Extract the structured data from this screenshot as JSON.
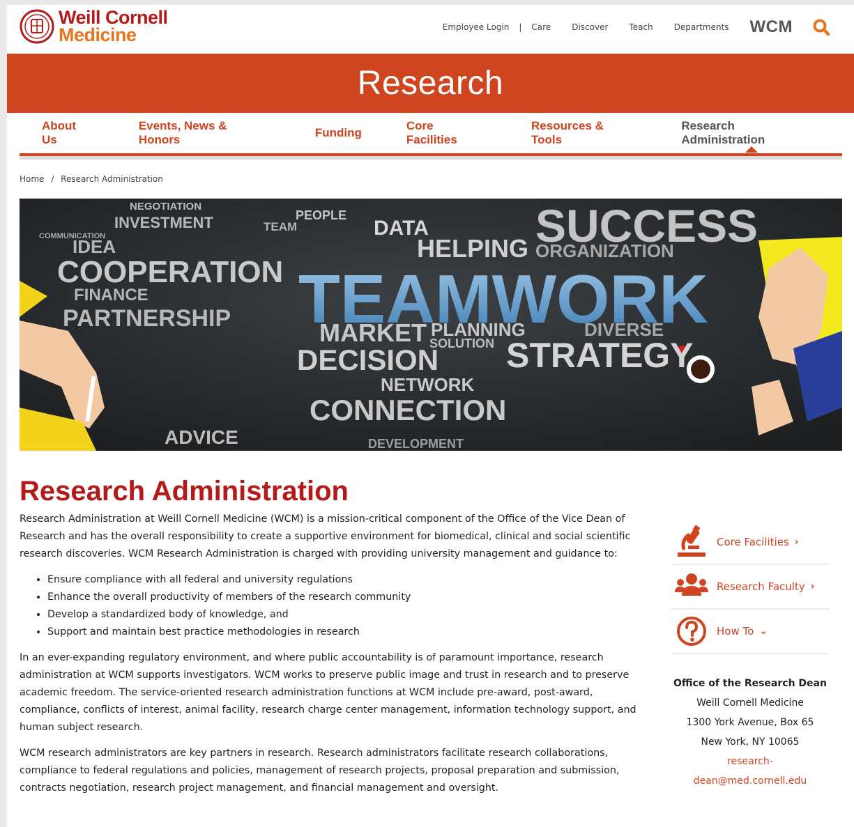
{
  "header": {
    "logo_line1": "Weill Cornell",
    "logo_line2": "Medicine",
    "utility": [
      "Employee Login",
      "Care",
      "Discover",
      "Teach",
      "Departments"
    ],
    "wcm": "WCM"
  },
  "banner": {
    "title": "Research"
  },
  "nav": {
    "items": [
      "About Us",
      "Events, News & Honors",
      "Funding",
      "Core Facilities",
      "Resources & Tools",
      "Research Administration"
    ],
    "active": "Research Administration"
  },
  "breadcrumb": {
    "home": "Home",
    "separator": "/",
    "current": "Research Administration"
  },
  "hero_words": {
    "teamwork": "TEAMWORK",
    "cooperation": "COOPERATION",
    "partnership": "PARTNERSHIP",
    "success": "SUCCESS",
    "helping": "HELPING",
    "organization": "ORGANIZATION",
    "data": "DATA",
    "market": "MARKET",
    "planning": "PLANNING",
    "diverse": "DIVERSE",
    "decision": "DECISION",
    "strategy": "STRATEGY",
    "connection": "CONNECTION",
    "network": "NETWORK",
    "advice": "ADVICE",
    "investment": "INVESTMENT",
    "negotiation": "NEGOTIATION",
    "idea": "IDEA",
    "finance": "FINANCE",
    "communication": "COMMUNICATION",
    "people": "PEOPLE",
    "team": "TEAM",
    "solution": "SOLUTION",
    "development": "DEVELOPMENT"
  },
  "page": {
    "title": "Research Administration",
    "intro": "Research Administration at Weill Cornell Medicine (WCM) is a mission-critical component of the Office of the Vice Dean of Research and has the overall responsibility to create a supportive environment for biomedical, clinical and social scientific research discoveries. WCM Research Administration is charged with providing university management and guidance to:",
    "bullets": [
      "Ensure compliance with all federal and university regulations",
      "Enhance the overall productivity of members of the research community",
      "Develop a standardized body of knowledge, and",
      "Support and maintain best practice methodologies in research"
    ],
    "para2": "In an ever-expanding regulatory environment, and where public accountability is of paramount importance, research administration at WCM supports investigators. WCM works to preserve public image and trust in research and to preserve academic freedom.   The service-oriented research administration functions at WCM include pre-award, post-award, compliance, conflicts of interest, animal facility, research charge center management, information technology support, and human subject research.",
    "para3": "WCM research administrators are key partners in research. Research administrators facilitate research collaborations, compliance to federal regulations and policies, management of research projects, proposal preparation and submission, contracts negotiation, research project management, and financial management and oversight."
  },
  "sidebar": {
    "items": [
      {
        "label": "Core Facilities",
        "icon": "microscope-icon",
        "chevron": "›"
      },
      {
        "label": "Research Faculty",
        "icon": "people-group-icon",
        "chevron": "›"
      },
      {
        "label": "How To",
        "icon": "question-icon",
        "chevron": "⌄"
      }
    ],
    "office": {
      "title": "Office of the Research Dean",
      "line1": "Weill Cornell Medicine",
      "line2": "1300 York Avenue, Box 65",
      "line3": "New York, NY 10065",
      "email": "research-dean@med.cornell.edu"
    }
  },
  "colors": {
    "brand_red": "#b31b1b",
    "brand_orange": "#cf4520",
    "logo_orange": "#e7751d"
  }
}
